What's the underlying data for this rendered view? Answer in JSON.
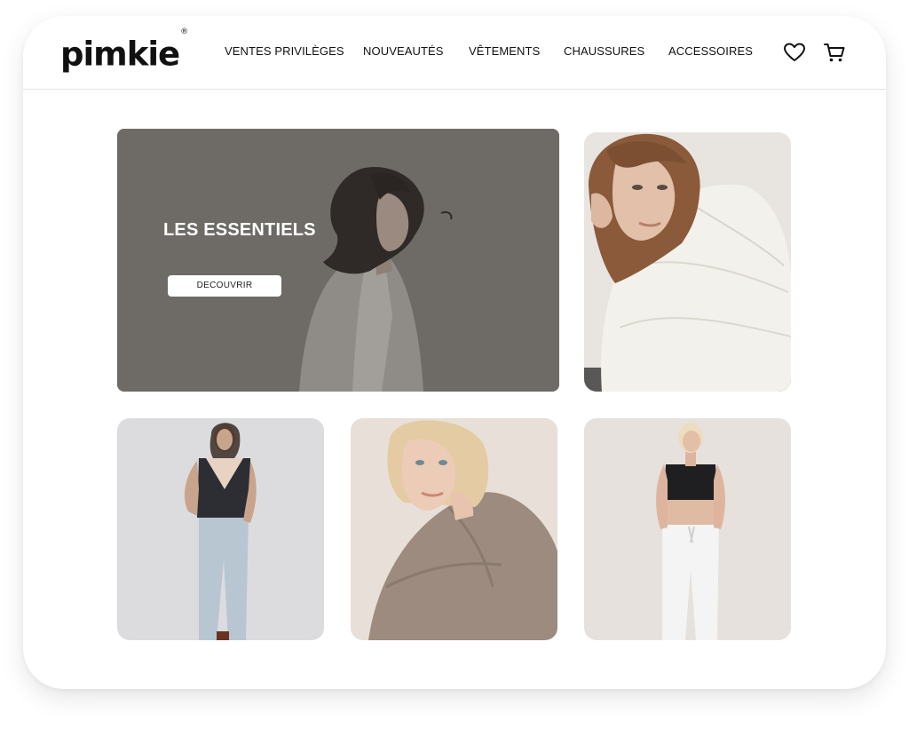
{
  "brand": {
    "name": "pimkie",
    "trademark": "®"
  },
  "nav": {
    "items": [
      {
        "label": "VENTES PRIVILÈGES"
      },
      {
        "label": "NOUVEAUTÉS"
      },
      {
        "label": "VÊTEMENTS"
      },
      {
        "label": "CHAUSSURES"
      },
      {
        "label": "ACCESSOIRES"
      }
    ]
  },
  "header_icons": {
    "wishlist": "heart-icon",
    "cart": "cart-icon"
  },
  "hero": {
    "title": "LES ESSENTIELS",
    "cta_label": "DECOUVRIR"
  },
  "tiles": [
    {
      "name": "white-puffer-jacket-photo"
    },
    {
      "name": "pinstripe-vest-jeans-photo"
    },
    {
      "name": "beige-knit-sweater-photo"
    },
    {
      "name": "crop-top-white-joggers-photo"
    }
  ],
  "colors": {
    "hero_bg": "#6e6a66",
    "accent": "#111111",
    "tile_bg": "#e9e6e3"
  }
}
